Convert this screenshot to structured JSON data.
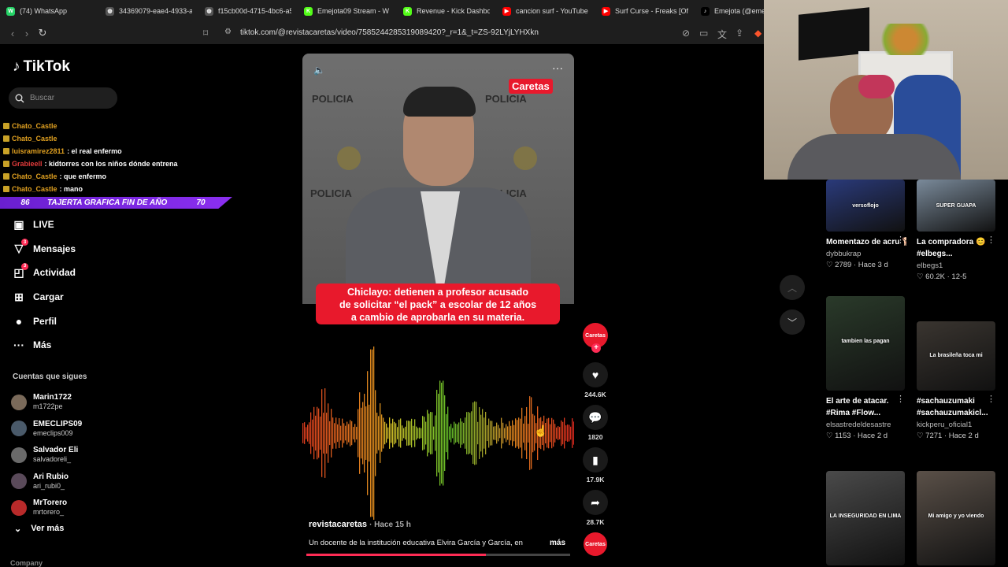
{
  "browser": {
    "tabs": [
      {
        "title": "(74) WhatsApp",
        "icon": "whatsapp-icon",
        "color": "#25d366",
        "glyph": "W"
      },
      {
        "title": "34369079-eae4-4933-add",
        "icon": "globe-icon",
        "color": "#555555",
        "glyph": "◍"
      },
      {
        "title": "f15cb00d-4715-4bc6-a58",
        "icon": "globe-icon",
        "color": "#555555",
        "glyph": "◍"
      },
      {
        "title": "Emejota09 Stream - W",
        "icon": "kick-icon",
        "color": "#53fc18",
        "glyph": "K"
      },
      {
        "title": "Revenue - Kick Dashboard",
        "icon": "kick-icon",
        "color": "#53fc18",
        "glyph": "K"
      },
      {
        "title": "cancion surf - YouTube",
        "icon": "youtube-icon",
        "color": "#ff0000",
        "glyph": "▶"
      },
      {
        "title": "Surf Curse - Freaks [Officia",
        "icon": "youtube-icon",
        "color": "#ff0000",
        "glyph": "▶"
      },
      {
        "title": "Emejota (@emej",
        "icon": "tiktok-icon",
        "color": "#000000",
        "glyph": "♪"
      }
    ],
    "url": "tiktok.com/@revistacaretas/video/7585244285319089420?_r=1&_t=ZS-92LYjLYHXkn"
  },
  "sidebar": {
    "logo": "TikTok",
    "search_placeholder": "Buscar",
    "menu": [
      {
        "label": "LIVE",
        "icon": "live-icon",
        "glyph": "▣",
        "badge": ""
      },
      {
        "label": "Mensajes",
        "icon": "messages-icon",
        "glyph": "▽",
        "badge": "3"
      },
      {
        "label": "Actividad",
        "icon": "activity-icon",
        "glyph": "◰",
        "badge": "3"
      },
      {
        "label": "Cargar",
        "icon": "upload-icon",
        "glyph": "⊞",
        "badge": ""
      },
      {
        "label": "Perfil",
        "icon": "profile-icon",
        "glyph": "●",
        "badge": ""
      },
      {
        "label": "Más",
        "icon": "more-icon",
        "glyph": "···",
        "badge": ""
      }
    ],
    "following_title": "Cuentas que sigues",
    "following": [
      {
        "name": "Marin1722",
        "handle": "m1722pe"
      },
      {
        "name": "EMECLIPS09",
        "handle": "emeclips009"
      },
      {
        "name": "Salvador Eli",
        "handle": "salvadoreli_"
      },
      {
        "name": "Ari Rubio",
        "handle": "ari_rubi0_"
      },
      {
        "name": "MrTorero",
        "handle": "mrtorero_"
      }
    ],
    "see_more": "Ver más",
    "company": "Company"
  },
  "chat_overlay": {
    "lines": [
      {
        "user": "Chato_Castle",
        "msg": "",
        "color": "#e0a020"
      },
      {
        "user": "Chato_Castle",
        "msg": "",
        "color": "#e0a020"
      },
      {
        "user": "luisramirez2811",
        "msg": ": el real enfermo",
        "color": "#e0a020"
      },
      {
        "user": "Grabieell",
        "msg": ": kidtorres con los niños dónde entrena",
        "color": "#e23b3b"
      },
      {
        "user": "Chato_Castle",
        "msg": ": que enfermo",
        "color": "#e0a020"
      },
      {
        "user": "Chato_Castle",
        "msg": ": mano",
        "color": "#e0a020"
      }
    ],
    "alert": {
      "left": "86",
      "text": "TAJERTA GRAFICA FIN DE AÑO",
      "right": "70"
    }
  },
  "video": {
    "brand": "Caretas",
    "caption_lines": [
      "Chiclayo: detienen a profesor acusado",
      "de solicitar “el pack” a escolar de 12 años",
      "a cambio de aprobarla en su materia."
    ],
    "wall_text": "POLICIA",
    "author": "revistacaretas",
    "time": "· Hace 15 h",
    "description": "Un docente de la institución educativa Elvira García y García, en",
    "more": "más",
    "progress": 0.68,
    "actions": [
      {
        "name": "like",
        "icon": "heart-icon",
        "glyph": "♥",
        "count": "244.6K"
      },
      {
        "name": "comment",
        "icon": "comment-icon",
        "glyph": "💬",
        "count": "1820"
      },
      {
        "name": "save",
        "icon": "bookmark-icon",
        "glyph": "▮",
        "count": "17.9K"
      },
      {
        "name": "share",
        "icon": "share-icon",
        "glyph": "➦",
        "count": "28.7K"
      }
    ]
  },
  "recommendations": [
    {
      "title": "Momentazo de acru 🐕",
      "title2": "",
      "user": "dybbukrap",
      "stats": "♡ 2789 · Hace 3 d",
      "overlay": "versoflojo",
      "bg": "#2a3a7a"
    },
    {
      "title": "La compradora 😊",
      "title2": "#elbegs...",
      "user": "elbegs1",
      "stats": "♡ 60.2K · 12-5",
      "overlay": "SUPER GUAPA",
      "bg": "#7a8a9a"
    },
    {
      "title": "El arte de atacar.",
      "title2": "#Rima #Flow...",
      "user": "elsastredeldesastre",
      "stats": "♡ 1153 · Hace 2 d",
      "overlay": "tambien las pagan",
      "bg": "#2a3a2a"
    },
    {
      "title": "#sachauzumaki",
      "title2": "#sachauzumakicl...",
      "user": "kickperu_oficial1",
      "stats": "♡ 7271 · Hace 2 d",
      "overlay": "La brasileña toca mi",
      "bg": "#3a3530"
    },
    {
      "title": "",
      "title2": "",
      "user": "",
      "stats": "",
      "overlay": "LA INSEGURIDAD EN LIMA",
      "bg": "#4a4a4a"
    },
    {
      "title": "",
      "title2": "",
      "user": "",
      "stats": "",
      "overlay": "Mi amigo y yo viendo",
      "bg": "#5a5048"
    }
  ]
}
